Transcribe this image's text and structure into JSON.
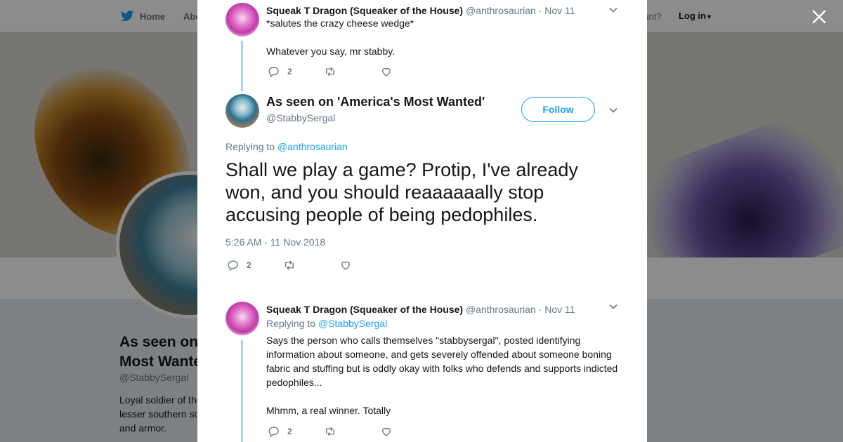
{
  "nav": {
    "home": "Home",
    "about": "Abo",
    "account_prompt": "ccount?",
    "login": "Log in"
  },
  "profile": {
    "name": "As seen on 'America's Most Wanted'",
    "name_visible_line1": "As seen on",
    "name_visible_line2": "Most Wante",
    "handle": "@StabbySergal",
    "bio_lines": [
      "Loyal soldier of the",
      "lesser southern sc",
      "and armor."
    ]
  },
  "colors": {
    "accent": "#1da1f2",
    "thread_line": "#a8d3f5",
    "muted": "#657786"
  },
  "modal": {
    "prev_tweet": {
      "name": "Squeak T Dragon (Squeaker of the House)",
      "handle": "@anthrosaurian",
      "date": "· Nov 11",
      "lines": [
        "*salutes the crazy cheese wedge*",
        "",
        "Whatever you say, mr stabby."
      ],
      "reply_count": "2",
      "avatar_icon": "dragon-avatar"
    },
    "main_tweet": {
      "name": "As seen on 'America's Most Wanted'",
      "handle": "@StabbySergal",
      "follow_label": "Follow",
      "replying_prefix": "Replying to",
      "replying_to": "@anthrosaurian",
      "text": "Shall we play a game? Protip, I've already won, and you should reaaaaaally stop accusing people of being pedophiles.",
      "timestamp": "5:26 AM - 11 Nov 2018",
      "reply_count": "2",
      "avatar_icon": "sergal-avatar"
    },
    "reply_tweet": {
      "name": "Squeak T Dragon (Squeaker of the House)",
      "handle": "@anthrosaurian",
      "date": "· Nov 11",
      "replying_prefix": "Replying to",
      "replying_to": "@StabbySergal",
      "text": "Says the person who calls themselves \"stabbysergal\", posted identifying information about someone, and gets severely offended about someone boning fabric and stuffing but is oddly okay with folks who defends and supports indicted pedophiles...",
      "text2": "Mhmm, a real winner. Totally",
      "reply_count": "2",
      "avatar_icon": "dragon-avatar"
    }
  }
}
